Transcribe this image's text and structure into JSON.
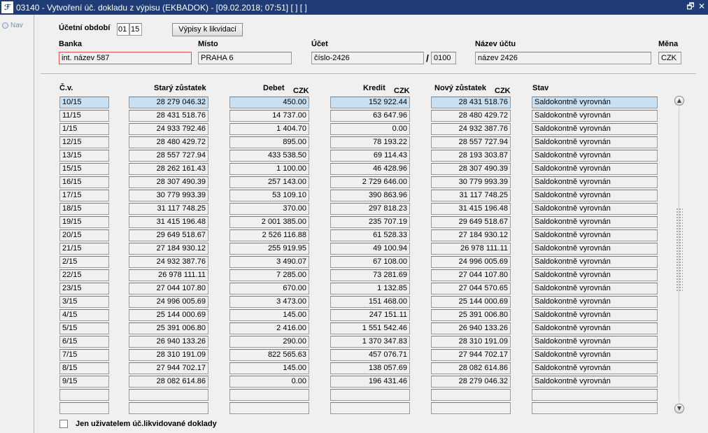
{
  "window": {
    "title": "03140 - Vytvoření úč. dokladu z výpisu (EKBADOK) - [09.02.2018; 07:51]  [ ]  [ ]",
    "icon_glyph": "ℱ",
    "restore_glyph": "🗗",
    "close_glyph": "✕"
  },
  "nav": {
    "label": "Nav"
  },
  "header": {
    "period_label": "Účetní období",
    "period_month": "01",
    "period_year": "15",
    "liquidation_button": "Výpisy k likvidaci",
    "bank_label": "Banka",
    "bank_value": "int. název 587",
    "place_label": "Místo",
    "place_value": "PRAHA 6",
    "account_label": "Účet",
    "account_value": "číslo-2426",
    "slash": "/",
    "bank_code": "0100",
    "account_name_label": "Název účtu",
    "account_name_value": "název 2426",
    "currency_label": "Měna",
    "currency_value": "CZK"
  },
  "table": {
    "headers": {
      "cv": "Č.v.",
      "old_balance": "Starý zůstatek",
      "debit": "Debet",
      "credit": "Kredit",
      "new_balance": "Nový zůstatek",
      "status": "Stav",
      "currency": "CZK"
    },
    "rows": [
      {
        "cv": "10/15",
        "old": "28 279 046.32",
        "debit": "450.00",
        "credit": "152 922.44",
        "new": "28 431 518.76",
        "status": "Saldokontně vyrovnán"
      },
      {
        "cv": "11/15",
        "old": "28 431 518.76",
        "debit": "14 737.00",
        "credit": "63 647.96",
        "new": "28 480 429.72",
        "status": "Saldokontně vyrovnán"
      },
      {
        "cv": "1/15",
        "old": "24 933 792.46",
        "debit": "1 404.70",
        "credit": "0.00",
        "new": "24 932 387.76",
        "status": "Saldokontně vyrovnán"
      },
      {
        "cv": "12/15",
        "old": "28 480 429.72",
        "debit": "895.00",
        "credit": "78 193.22",
        "new": "28 557 727.94",
        "status": "Saldokontně vyrovnán"
      },
      {
        "cv": "13/15",
        "old": "28 557 727.94",
        "debit": "433 538.50",
        "credit": "69 114.43",
        "new": "28 193 303.87",
        "status": "Saldokontně vyrovnán"
      },
      {
        "cv": "15/15",
        "old": "28 262 161.43",
        "debit": "1 100.00",
        "credit": "46 428.96",
        "new": "28 307 490.39",
        "status": "Saldokontně vyrovnán"
      },
      {
        "cv": "16/15",
        "old": "28 307 490.39",
        "debit": "257 143.00",
        "credit": "2 729 646.00",
        "new": "30 779 993.39",
        "status": "Saldokontně vyrovnán"
      },
      {
        "cv": "17/15",
        "old": "30 779 993.39",
        "debit": "53 109.10",
        "credit": "390 863.96",
        "new": "31 117 748.25",
        "status": "Saldokontně vyrovnán"
      },
      {
        "cv": "18/15",
        "old": "31 117 748.25",
        "debit": "370.00",
        "credit": "297 818.23",
        "new": "31 415 196.48",
        "status": "Saldokontně vyrovnán"
      },
      {
        "cv": "19/15",
        "old": "31 415 196.48",
        "debit": "2 001 385.00",
        "credit": "235 707.19",
        "new": "29 649 518.67",
        "status": "Saldokontně vyrovnán"
      },
      {
        "cv": "20/15",
        "old": "29 649 518.67",
        "debit": "2 526 116.88",
        "credit": "61 528.33",
        "new": "27 184 930.12",
        "status": "Saldokontně vyrovnán"
      },
      {
        "cv": "21/15",
        "old": "27 184 930.12",
        "debit": "255 919.95",
        "credit": "49 100.94",
        "new": "26 978 111.11",
        "status": "Saldokontně vyrovnán"
      },
      {
        "cv": "2/15",
        "old": "24 932 387.76",
        "debit": "3 490.07",
        "credit": "67 108.00",
        "new": "24 996 005.69",
        "status": "Saldokontně vyrovnán"
      },
      {
        "cv": "22/15",
        "old": "26 978 111.11",
        "debit": "7 285.00",
        "credit": "73 281.69",
        "new": "27 044 107.80",
        "status": "Saldokontně vyrovnán"
      },
      {
        "cv": "23/15",
        "old": "27 044 107.80",
        "debit": "670.00",
        "credit": "1 132.85",
        "new": "27 044 570.65",
        "status": "Saldokontně vyrovnán"
      },
      {
        "cv": "3/15",
        "old": "24 996 005.69",
        "debit": "3 473.00",
        "credit": "151 468.00",
        "new": "25 144 000.69",
        "status": "Saldokontně vyrovnán"
      },
      {
        "cv": "4/15",
        "old": "25 144 000.69",
        "debit": "145.00",
        "credit": "247 151.11",
        "new": "25 391 006.80",
        "status": "Saldokontně vyrovnán"
      },
      {
        "cv": "5/15",
        "old": "25 391 006.80",
        "debit": "2 416.00",
        "credit": "1 551 542.46",
        "new": "26 940 133.26",
        "status": "Saldokontně vyrovnán"
      },
      {
        "cv": "6/15",
        "old": "26 940 133.26",
        "debit": "290.00",
        "credit": "1 370 347.83",
        "new": "28 310 191.09",
        "status": "Saldokontně vyrovnán"
      },
      {
        "cv": "7/15",
        "old": "28 310 191.09",
        "debit": "822 565.63",
        "credit": "457 076.71",
        "new": "27 944 702.17",
        "status": "Saldokontně vyrovnán"
      },
      {
        "cv": "8/15",
        "old": "27 944 702.17",
        "debit": "145.00",
        "credit": "138 057.69",
        "new": "28 082 614.86",
        "status": "Saldokontně vyrovnán"
      },
      {
        "cv": "9/15",
        "old": "28 082 614.86",
        "debit": "0.00",
        "credit": "196 431.46",
        "new": "28 279 046.32",
        "status": "Saldokontně vyrovnán"
      },
      {
        "cv": "",
        "old": "",
        "debit": "",
        "credit": "",
        "new": "",
        "status": ""
      },
      {
        "cv": "",
        "old": "",
        "debit": "",
        "credit": "",
        "new": "",
        "status": ""
      }
    ],
    "selected_row": 0
  },
  "scroll": {
    "up_glyph": "▲",
    "down_glyph": "▼"
  },
  "footer": {
    "only_user_label": "Jen uživatelem úč.likvidované doklady"
  }
}
